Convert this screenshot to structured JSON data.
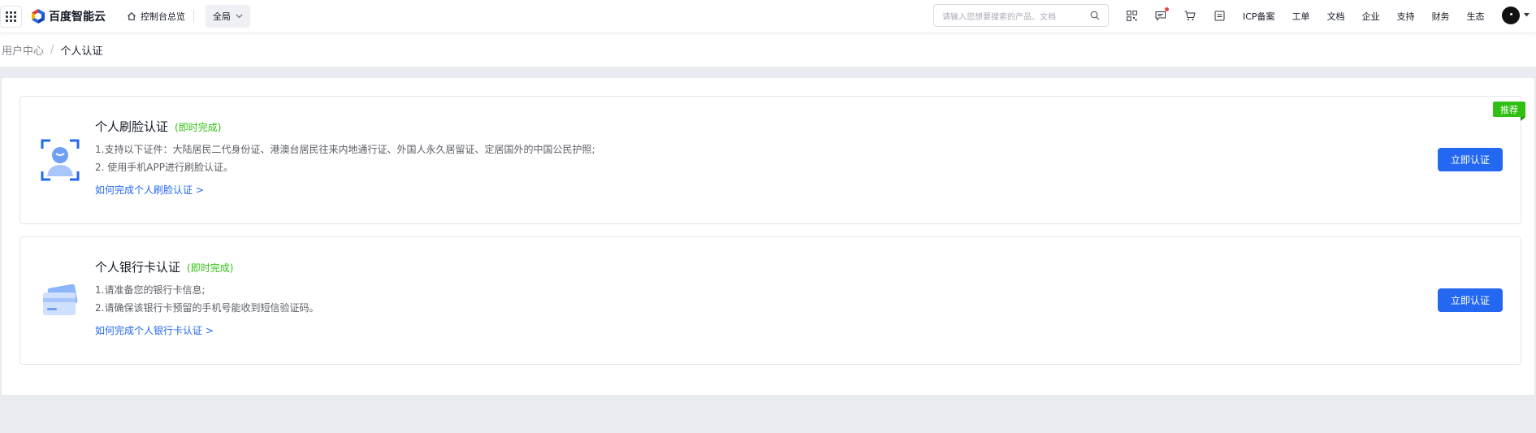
{
  "topbar": {
    "brand": "百度智能云",
    "console_home": "控制台总览",
    "region": "全局",
    "search_placeholder": "请输入您想要搜索的产品、文档",
    "links": [
      "ICP备案",
      "工单",
      "文档",
      "企业",
      "支持",
      "财务",
      "生态"
    ],
    "icons": [
      "qrcode-icon",
      "message-icon",
      "cart-icon",
      "bill-icon"
    ],
    "message_has_unread": true
  },
  "breadcrumb": {
    "parent": "用户中心",
    "separator": "/",
    "current": "个人认证"
  },
  "cards": [
    {
      "title": "个人刷脸认证",
      "tag": "(即时完成)",
      "lines": [
        "1.支持以下证件：大陆居民二代身份证、港澳台居民往来内地通行证、外国人永久居留证、定居国外的中国公民护照;",
        "2. 使用手机APP进行刷脸认证。"
      ],
      "howto": "如何完成个人刷脸认证 >",
      "button": "立即认证",
      "badge": "推荐"
    },
    {
      "title": "个人银行卡认证",
      "tag": "(即时完成)",
      "lines": [
        "1.请准备您的银行卡信息;",
        "2.请确保该银行卡预留的手机号能收到短信验证码。"
      ],
      "howto": "如何完成个人银行卡认证 >",
      "button": "立即认证"
    }
  ],
  "colors": {
    "primary": "#2468f2",
    "success": "#30bf13",
    "page_bg": "#e8ecf1"
  }
}
